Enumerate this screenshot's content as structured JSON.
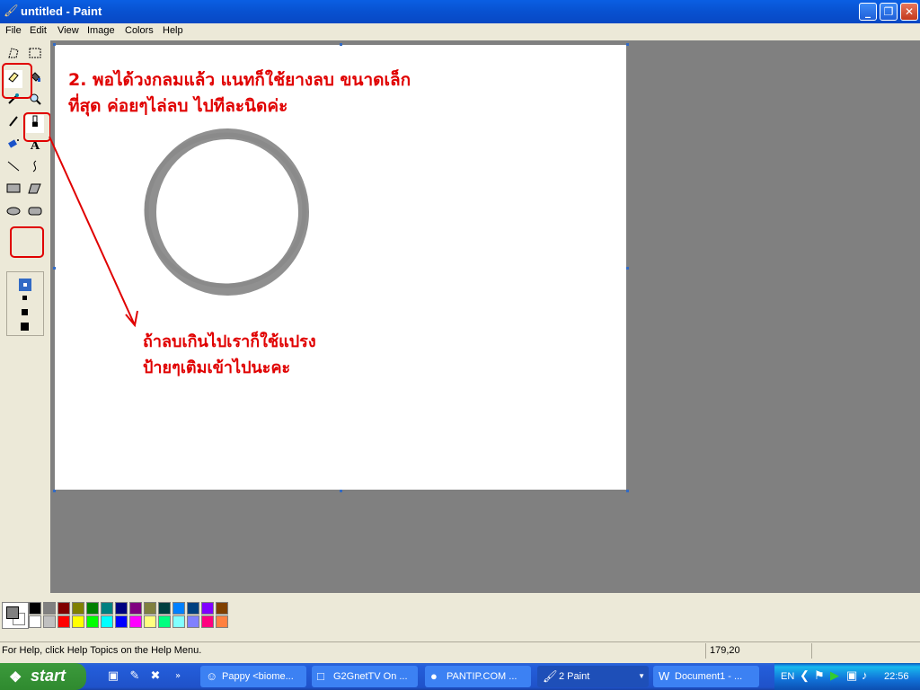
{
  "window": {
    "title": "untitled - Paint",
    "minimize": "_",
    "restore": "❐",
    "close": "✕"
  },
  "menu": [
    "File",
    "Edit",
    "View",
    "Image",
    "Colors",
    "Help"
  ],
  "tools": [
    "free-select",
    "rect-select",
    "eraser",
    "fill",
    "pick-color",
    "magnifier",
    "pencil",
    "brush",
    "airbrush",
    "text",
    "line",
    "curve",
    "rectangle",
    "polygon",
    "ellipse",
    "rounded-rectangle"
  ],
  "annotations": {
    "step_line1": "2. พอได้วงกลมแล้ว แนทก็ใช้ยางลบ ขนาดเล็ก",
    "step_line2": "ที่สุด ค่อยๆไล่ลบ ไปทีละนิดค่ะ",
    "tip_line1": "ถ้าลบเกินไปเราก็ใช้แปรง",
    "tip_line2": "ป้ายๆเติมเข้าไปนะคะ",
    "color": "#e00000"
  },
  "palette": {
    "row1": [
      "#000000",
      "#808080",
      "#800000",
      "#808000",
      "#008000",
      "#008080",
      "#000080",
      "#800080",
      "#808040",
      "#004040",
      "#0080ff",
      "#004080",
      "#8000ff",
      "#804000"
    ],
    "row2": [
      "#ffffff",
      "#c0c0c0",
      "#ff0000",
      "#ffff00",
      "#00ff00",
      "#00ffff",
      "#0000ff",
      "#ff00ff",
      "#ffff80",
      "#00ff80",
      "#80ffff",
      "#8080ff",
      "#ff0080",
      "#ff8040"
    ]
  },
  "status": {
    "help": "For Help, click Help Topics on the Help Menu.",
    "coords": "179,20"
  },
  "taskbar": {
    "start": "start",
    "tasks": [
      {
        "label": "Pappy <biome...",
        "icon": "person-icon"
      },
      {
        "label": "G2GnetTV On ...",
        "icon": "monitor-icon"
      },
      {
        "label": "PANTIP.COM ...",
        "icon": "firefox-icon"
      },
      {
        "label": "2 Paint",
        "icon": "paint-icon"
      },
      {
        "label": "Document1 - ...",
        "icon": "word-icon"
      }
    ],
    "lang": "EN",
    "time": "22:56"
  }
}
